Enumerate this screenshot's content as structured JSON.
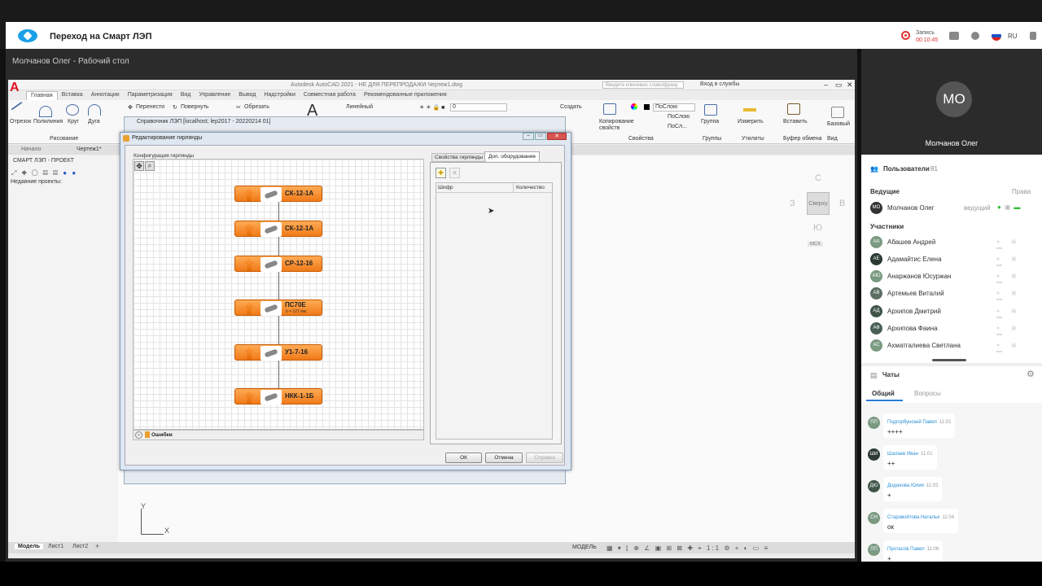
{
  "app": {
    "title": "Переход на Смарт ЛЭП",
    "rec_label": "Запись",
    "rec_time": "00:10:45",
    "lang": "RU"
  },
  "share": {
    "title": "Молчанов Олег - Рабочий стол"
  },
  "acad": {
    "doc_title": "Autodesk AutoCAD 2021 - НЕ ДЛЯ ПЕРЕПРОДАЖИ   Чертеж1.dwg",
    "search_placeholder": "Введите ключевое слово/фразу",
    "login": "Вход в службы",
    "tabs": [
      "Главная",
      "Вставка",
      "Аннотации",
      "Параметризация",
      "Вид",
      "Управление",
      "Вывод",
      "Надстройки",
      "Совместная работа",
      "Рекомендованные приложения"
    ],
    "ribbon": {
      "line": "Отрезок",
      "polyline": "Полилиния",
      "circle": "Круг",
      "arc": "Дуга",
      "move": "Перенести",
      "rotate": "Повернуть",
      "trim": "Обрезать",
      "linear": "Линейный",
      "create": "Создать",
      "copy_props": "Копирование свойств",
      "bylayer": "ПоСлою",
      "bylayer2": "ПоСлою",
      "bylayer3": "ПоСл...",
      "group": "Группа",
      "measure": "Измерить",
      "paste": "Вставить",
      "base": "Базовый",
      "layer_val": "0"
    },
    "groups": {
      "draw": "Рисование",
      "props": "Свойства",
      "groups": "Группы",
      "utils": "Утилиты",
      "clipboard": "Буфер обмена",
      "view": "Вид"
    },
    "doc_tabs": {
      "start": "Начало",
      "drawing": "Чертеж1*"
    },
    "left_panel": {
      "title": "СМАРТ ЛЭП - ПРОЕКТ",
      "recent": "Недавние проекты:"
    },
    "viewcube": {
      "top": "Сверху",
      "n": "С",
      "s": "Ю",
      "w": "З",
      "e": "В",
      "wcs": "МСК"
    },
    "layouts": {
      "model": "Модель",
      "sheet1": "Лист1",
      "sheet2": "Лист2"
    },
    "status_model": "МОДЕЛЬ"
  },
  "dialog_bg": {
    "title": "Справочник ЛЭП [localhost; lep2017 - 20220214 01]"
  },
  "dialog": {
    "title": "Редактирование гирлянды",
    "config_label": "Конфигурация гирлянды",
    "items": [
      {
        "label": "СК-12-1А",
        "sub": ""
      },
      {
        "label": "СК-12-1А",
        "sub": ""
      },
      {
        "label": "СР-12-16",
        "sub": ""
      },
      {
        "label": "ПС70Е",
        "sub": "h = 127 мм"
      },
      {
        "label": "У1-7-16",
        "sub": ""
      },
      {
        "label": "НКК-1-1Б",
        "sub": ""
      }
    ],
    "errors": "Ошибки",
    "tab_props": "Свойства гирлянды",
    "tab_equipment": "Доп. оборудование",
    "col_cipher": "Шифр",
    "col_qty": "Количество",
    "ok": "ОК",
    "cancel": "Отмена",
    "help": "Справка"
  },
  "sidebar": {
    "host_initials": "МО",
    "host_name": "Молчанов Олег",
    "users_label": "Пользователи",
    "users_count": "81",
    "host_label": "Ведущие",
    "rights_label": "Права",
    "host_row": {
      "initials": "МО",
      "name": "Молчанов Олег",
      "role": "ведущий"
    },
    "participants_label": "Участники",
    "participants": [
      {
        "initials": "АА",
        "name": "Абашев Андрей"
      },
      {
        "initials": "АЕ",
        "name": "Адамайтис Елена"
      },
      {
        "initials": "АЮ",
        "name": "Анаржанов Юсуржан"
      },
      {
        "initials": "АВ",
        "name": "Артемьев Виталий"
      },
      {
        "initials": "АД",
        "name": "Архипов Дмитрий"
      },
      {
        "initials": "АФ",
        "name": "Архипова Фаина"
      },
      {
        "initials": "АС",
        "name": "Ахматгалиева Светлана"
      }
    ],
    "chats_label": "Чаты",
    "tab_general": "Общий",
    "tab_questions": "Вопросы",
    "messages": [
      {
        "initials": "ПП",
        "name": "Подгорбунский Павел",
        "time": "11:01",
        "text": "++++"
      },
      {
        "initials": "ШИ",
        "name": "Шалаев Иван",
        "time": "11:01",
        "text": "++"
      },
      {
        "initials": "ДЮ",
        "name": "Додонова Юлия",
        "time": "11:03",
        "text": "+"
      },
      {
        "initials": "СН",
        "name": "Старовойтова Наталья",
        "time": "11:04",
        "text": "ок"
      },
      {
        "initials": "ПП",
        "name": "Протасов Павел",
        "time": "11:06",
        "text": "+"
      }
    ]
  },
  "colors": {
    "accent": "#2a7bd5",
    "item_orange": "#f07a18",
    "rec": "#dd3333"
  }
}
